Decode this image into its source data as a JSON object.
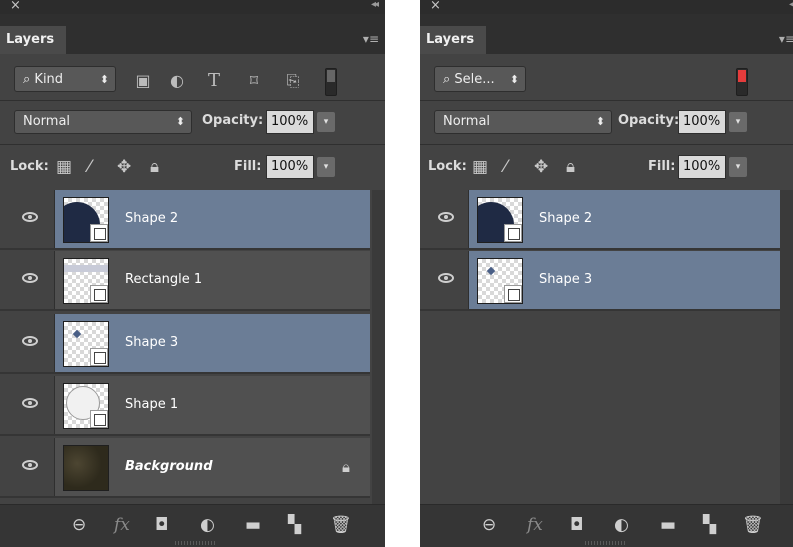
{
  "left": {
    "tab": "Layers",
    "menu_icon": "panel-menu-icon",
    "filter": {
      "label": "Kind",
      "icons": [
        "image-filter-icon",
        "adjustment-filter-icon",
        "type-filter-icon",
        "shape-filter-icon",
        "smart-object-filter-icon"
      ],
      "toggle_on": false
    },
    "blend_mode": "Normal",
    "opacity_label": "Opacity:",
    "opacity_value": "100%",
    "lock_label": "Lock:",
    "fill_label": "Fill:",
    "fill_value": "100%",
    "layers": [
      {
        "name": "Shape 2",
        "selected": true,
        "thumb": "circle-dark"
      },
      {
        "name": "Rectangle 1",
        "selected": false,
        "thumb": "rect-strip"
      },
      {
        "name": "Shape 3",
        "selected": true,
        "thumb": "diamond"
      },
      {
        "name": "Shape 1",
        "selected": false,
        "thumb": "circle-outline"
      },
      {
        "name": "Background",
        "selected": false,
        "thumb": "background",
        "locked": true
      }
    ]
  },
  "right": {
    "tab": "Layers",
    "filter": {
      "label": "Sele...",
      "toggle_on": true
    },
    "blend_mode": "Normal",
    "opacity_label": "Opacity:",
    "opacity_value": "100%",
    "lock_label": "Lock:",
    "fill_label": "Fill:",
    "fill_value": "100%",
    "layers": [
      {
        "name": "Shape 2",
        "selected": true,
        "thumb": "circle-dark"
      },
      {
        "name": "Shape 3",
        "selected": true,
        "thumb": "diamond"
      }
    ]
  },
  "colors": {
    "panel_bg": "#434343",
    "selected_layer": "#6b7d96",
    "toggle_on": "#e53c3c"
  }
}
